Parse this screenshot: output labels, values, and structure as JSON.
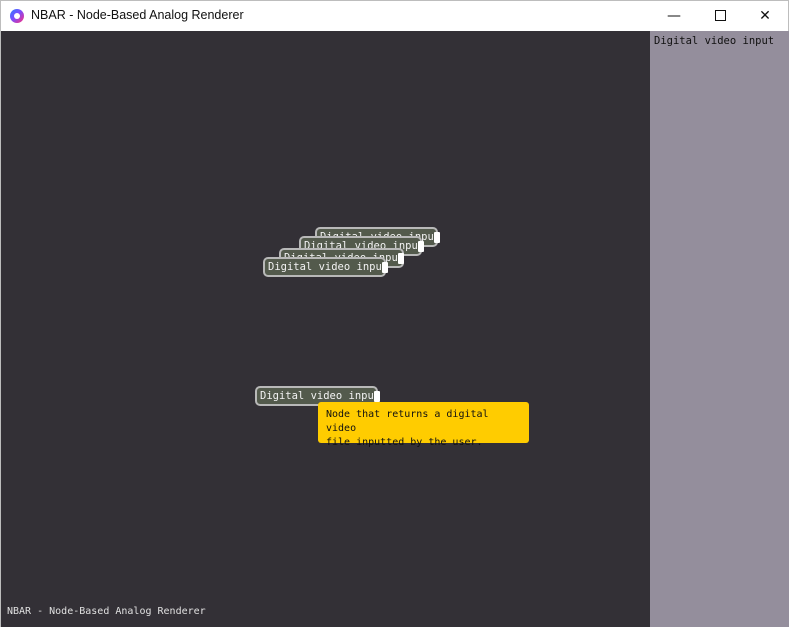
{
  "window": {
    "title": "NBAR - Node-Based Analog Renderer",
    "controls": {
      "minimize": "—",
      "close": "✕"
    }
  },
  "sidebar": {
    "item": "Digital video input"
  },
  "nodes": [
    {
      "label": "Digital video input"
    },
    {
      "label": "Digital video input"
    },
    {
      "label": "Digital video input"
    },
    {
      "label": "Digital video input"
    },
    {
      "label": "Digital video input"
    }
  ],
  "tooltip": {
    "line1": "Node that returns a digital video",
    "line2": "file inputted by the user."
  },
  "status_text": "NBAR - Node-Based Analog Renderer",
  "colors": {
    "canvas": "#333036",
    "sidebar": "#948e9c",
    "node_fill": "#535a4c",
    "node_border": "#b8b8b8",
    "tooltip": "#ffcc00"
  }
}
